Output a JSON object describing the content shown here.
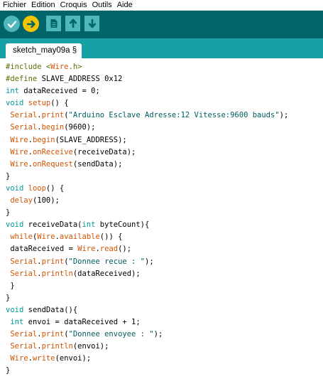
{
  "menu": [
    "Fichier",
    "Edition",
    "Croquis",
    "Outils",
    "Aide"
  ],
  "toolbar": {
    "buttons": [
      {
        "name": "verify-button",
        "icon": "checkmark-icon"
      },
      {
        "name": "upload-button",
        "icon": "arrow-right-icon"
      },
      {
        "name": "new-button",
        "icon": "document-icon"
      },
      {
        "name": "open-button",
        "icon": "arrow-up-icon"
      },
      {
        "name": "save-button",
        "icon": "arrow-down-icon"
      }
    ],
    "accent": "#006468",
    "button_color": "#4db7bb",
    "active_color": "#f3c400"
  },
  "tab": {
    "label": "sketch_may09a §"
  },
  "code_lines": [
    [
      [
        "dir",
        "#include <"
      ],
      [
        "func",
        "Wire"
      ],
      [
        "dir",
        ".h>"
      ]
    ],
    [
      [
        "dir",
        "#define"
      ],
      [
        "plain",
        " SLAVE_ADDRESS 0x12"
      ]
    ],
    [
      [
        "type",
        "int"
      ],
      [
        "plain",
        " dataReceived = 0;"
      ]
    ],
    [
      [
        "type",
        "void"
      ],
      [
        "plain",
        " "
      ],
      [
        "func",
        "setup"
      ],
      [
        "plain",
        "() {"
      ]
    ],
    [
      [
        "plain",
        " "
      ],
      [
        "func",
        "Serial"
      ],
      [
        "plain",
        "."
      ],
      [
        "func",
        "print"
      ],
      [
        "plain",
        "("
      ],
      [
        "str",
        "\"Arduino Esclave Adresse:12 Vitesse:9600 bauds\""
      ],
      [
        "plain",
        ");"
      ]
    ],
    [
      [
        "plain",
        " "
      ],
      [
        "func",
        "Serial"
      ],
      [
        "plain",
        "."
      ],
      [
        "func",
        "begin"
      ],
      [
        "plain",
        "(9600);"
      ]
    ],
    [
      [
        "plain",
        " "
      ],
      [
        "func",
        "Wire"
      ],
      [
        "plain",
        "."
      ],
      [
        "func",
        "begin"
      ],
      [
        "plain",
        "(SLAVE_ADDRESS);"
      ]
    ],
    [
      [
        "plain",
        " "
      ],
      [
        "func",
        "Wire"
      ],
      [
        "plain",
        "."
      ],
      [
        "func",
        "onReceive"
      ],
      [
        "plain",
        "(receiveData);"
      ]
    ],
    [
      [
        "plain",
        " "
      ],
      [
        "func",
        "Wire"
      ],
      [
        "plain",
        "."
      ],
      [
        "func",
        "onRequest"
      ],
      [
        "plain",
        "(sendData);"
      ]
    ],
    [
      [
        "plain",
        "}"
      ]
    ],
    [
      [
        "type",
        "void"
      ],
      [
        "plain",
        " "
      ],
      [
        "func",
        "loop"
      ],
      [
        "plain",
        "() {"
      ]
    ],
    [
      [
        "plain",
        " "
      ],
      [
        "func",
        "delay"
      ],
      [
        "plain",
        "(100);"
      ]
    ],
    [
      [
        "plain",
        "}"
      ]
    ],
    [
      [
        "type",
        "void"
      ],
      [
        "plain",
        " receiveData("
      ],
      [
        "type",
        "int"
      ],
      [
        "plain",
        " byteCount){"
      ]
    ],
    [
      [
        "plain",
        " "
      ],
      [
        "func",
        "while"
      ],
      [
        "plain",
        "("
      ],
      [
        "func",
        "Wire"
      ],
      [
        "plain",
        "."
      ],
      [
        "func",
        "available"
      ],
      [
        "plain",
        "()) {"
      ]
    ],
    [
      [
        "plain",
        " dataReceived = "
      ],
      [
        "func",
        "Wire"
      ],
      [
        "plain",
        "."
      ],
      [
        "func",
        "read"
      ],
      [
        "plain",
        "();"
      ]
    ],
    [
      [
        "plain",
        " "
      ],
      [
        "func",
        "Serial"
      ],
      [
        "plain",
        "."
      ],
      [
        "func",
        "print"
      ],
      [
        "plain",
        "("
      ],
      [
        "str",
        "\"Donnee recue : \""
      ],
      [
        "plain",
        ");"
      ]
    ],
    [
      [
        "plain",
        " "
      ],
      [
        "func",
        "Serial"
      ],
      [
        "plain",
        "."
      ],
      [
        "func",
        "println"
      ],
      [
        "plain",
        "(dataReceived);"
      ]
    ],
    [
      [
        "plain",
        " }"
      ]
    ],
    [
      [
        "plain",
        "}"
      ]
    ],
    [
      [
        "type",
        "void"
      ],
      [
        "plain",
        " sendData(){"
      ]
    ],
    [
      [
        "plain",
        " "
      ],
      [
        "type",
        "int"
      ],
      [
        "plain",
        " envoi = dataReceived + 1;"
      ]
    ],
    [
      [
        "plain",
        " "
      ],
      [
        "func",
        "Serial"
      ],
      [
        "plain",
        "."
      ],
      [
        "func",
        "print"
      ],
      [
        "plain",
        "("
      ],
      [
        "str",
        "\"Donnee envoyee : \""
      ],
      [
        "plain",
        ");"
      ]
    ],
    [
      [
        "plain",
        " "
      ],
      [
        "func",
        "Serial"
      ],
      [
        "plain",
        "."
      ],
      [
        "func",
        "println"
      ],
      [
        "plain",
        "(envoi);"
      ]
    ],
    [
      [
        "plain",
        " "
      ],
      [
        "func",
        "Wire"
      ],
      [
        "plain",
        "."
      ],
      [
        "func",
        "write"
      ],
      [
        "plain",
        "(envoi);"
      ]
    ],
    [
      [
        "plain",
        "}"
      ]
    ]
  ]
}
